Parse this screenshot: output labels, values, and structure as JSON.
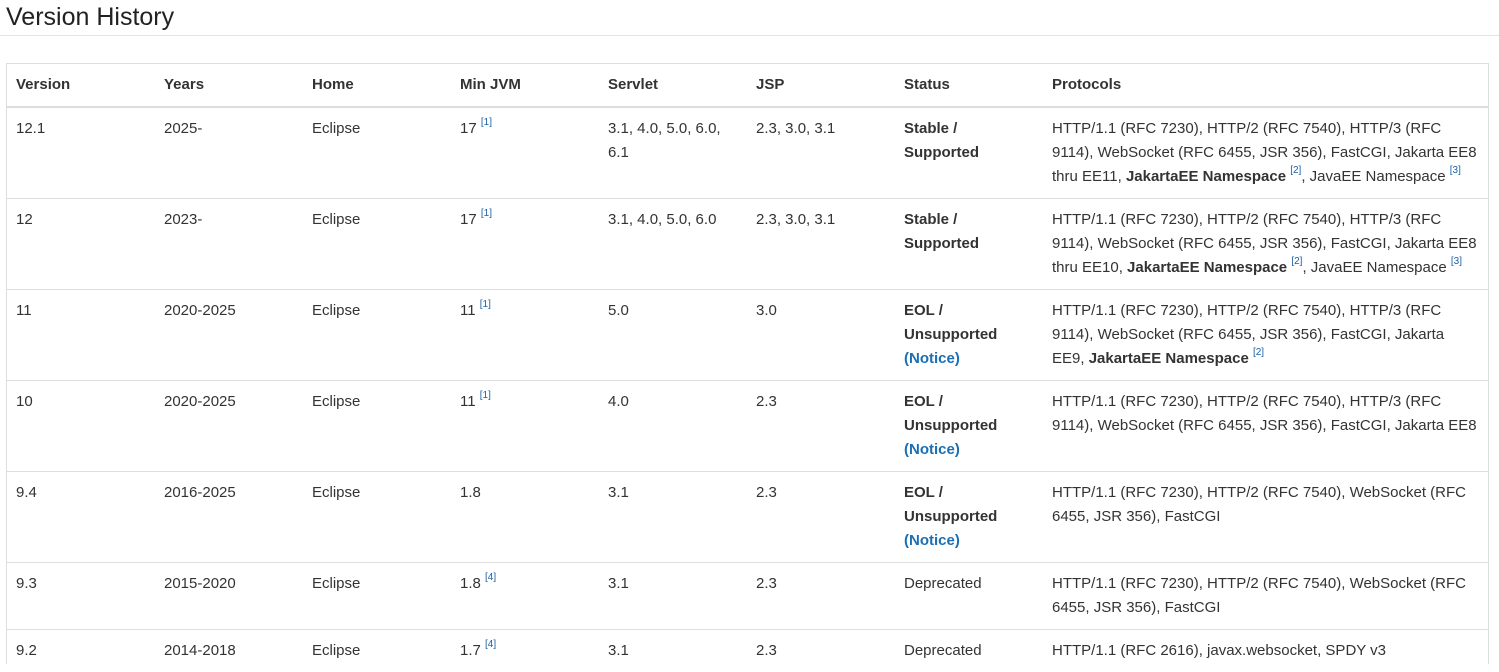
{
  "page": {
    "title": "Version History"
  },
  "table": {
    "headers": [
      "Version",
      "Years",
      "Home",
      "Min JVM",
      "Servlet",
      "JSP",
      "Status",
      "Protocols"
    ],
    "rows": [
      {
        "version": "12.1",
        "years": "2025-",
        "home": "Eclipse",
        "min_jvm": "17",
        "min_jvm_ref": "[1]",
        "servlet": "3.1, 4.0, 5.0, 6.0, 6.1",
        "jsp": "2.3, 3.0, 3.1",
        "status": "Stable / Supported",
        "status_bold": true,
        "notice": "",
        "protocols_text": "HTTP/1.1 (RFC 7230), HTTP/2 (RFC 7540), HTTP/3 (RFC 9114), WebSocket (RFC 6455, JSR 356), FastCGI, Jakarta EE8 thru EE11, ",
        "protocols_bold": "JakartaEE Namespace",
        "protocols_ref1": "[2]",
        "protocols_tail": ", JavaEE Namespace ",
        "protocols_ref2": "[3]"
      },
      {
        "version": "12",
        "years": "2023-",
        "home": "Eclipse",
        "min_jvm": "17",
        "min_jvm_ref": "[1]",
        "servlet": "3.1, 4.0, 5.0, 6.0",
        "jsp": "2.3, 3.0, 3.1",
        "status": "Stable / Supported",
        "status_bold": true,
        "notice": "",
        "protocols_text": "HTTP/1.1 (RFC 7230), HTTP/2 (RFC 7540), HTTP/3 (RFC 9114), WebSocket (RFC 6455, JSR 356), FastCGI, Jakarta EE8 thru EE10, ",
        "protocols_bold": "JakartaEE Namespace",
        "protocols_ref1": "[2]",
        "protocols_tail": ", JavaEE Namespace ",
        "protocols_ref2": "[3]"
      },
      {
        "version": "11",
        "years": "2020-2025",
        "home": "Eclipse",
        "min_jvm": "11",
        "min_jvm_ref": "[1]",
        "servlet": "5.0",
        "jsp": "3.0",
        "status": "EOL / Unsupported",
        "status_bold": true,
        "notice": "(Notice)",
        "protocols_text": "HTTP/1.1 (RFC 7230), HTTP/2 (RFC 7540), HTTP/3 (RFC 9114), WebSocket (RFC 6455, JSR 356), FastCGI, Jakarta EE9, ",
        "protocols_bold": "JakartaEE Namespace",
        "protocols_ref1": "[2]",
        "protocols_tail": "",
        "protocols_ref2": ""
      },
      {
        "version": "10",
        "years": "2020-2025",
        "home": "Eclipse",
        "min_jvm": "11",
        "min_jvm_ref": "[1]",
        "servlet": "4.0",
        "jsp": "2.3",
        "status": "EOL / Unsupported",
        "status_bold": true,
        "notice": "(Notice)",
        "protocols_text": "HTTP/1.1 (RFC 7230), HTTP/2 (RFC 7540), HTTP/3 (RFC 9114), WebSocket (RFC 6455, JSR 356), FastCGI, Jakarta EE8",
        "protocols_bold": "",
        "protocols_ref1": "",
        "protocols_tail": "",
        "protocols_ref2": ""
      },
      {
        "version": "9.4",
        "years": "2016-2025",
        "home": "Eclipse",
        "min_jvm": "1.8",
        "min_jvm_ref": "",
        "servlet": "3.1",
        "jsp": "2.3",
        "status": "EOL / Unsupported",
        "status_bold": true,
        "notice": "(Notice)",
        "protocols_text": "HTTP/1.1 (RFC 7230), HTTP/2 (RFC 7540), WebSocket (RFC 6455, JSR 356), FastCGI",
        "protocols_bold": "",
        "protocols_ref1": "",
        "protocols_tail": "",
        "protocols_ref2": ""
      },
      {
        "version": "9.3",
        "years": "2015-2020",
        "home": "Eclipse",
        "min_jvm": "1.8",
        "min_jvm_ref": "[4]",
        "servlet": "3.1",
        "jsp": "2.3",
        "status": "Deprecated",
        "status_bold": false,
        "notice": "",
        "protocols_text": "HTTP/1.1 (RFC 7230), HTTP/2 (RFC 7540), WebSocket (RFC 6455, JSR 356), FastCGI",
        "protocols_bold": "",
        "protocols_ref1": "",
        "protocols_tail": "",
        "protocols_ref2": ""
      },
      {
        "version": "9.2",
        "years": "2014-2018",
        "home": "Eclipse",
        "min_jvm": "1.7",
        "min_jvm_ref": "[4]",
        "servlet": "3.1",
        "jsp": "2.3",
        "status": "Deprecated",
        "status_bold": false,
        "notice": "",
        "protocols_text": "HTTP/1.1 (RFC 2616), javax.websocket, SPDY v3",
        "protocols_bold": "",
        "protocols_ref1": "",
        "protocols_tail": "",
        "protocols_ref2": ""
      }
    ]
  }
}
